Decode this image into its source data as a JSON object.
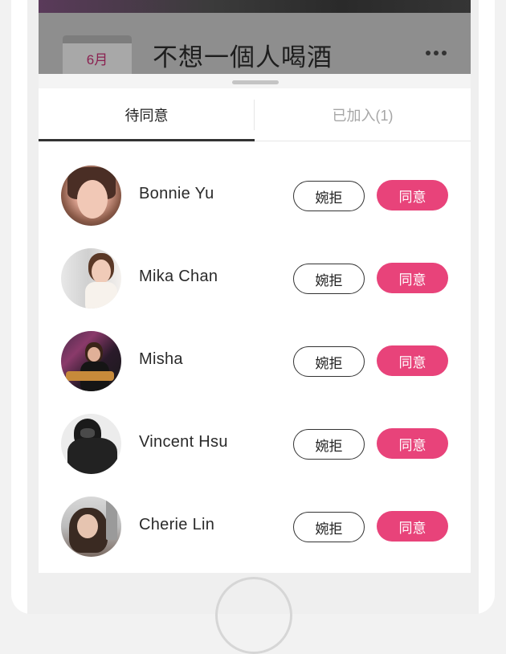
{
  "event": {
    "month": "6月",
    "title": "不想一個人喝酒"
  },
  "tabs": [
    {
      "label": "待同意",
      "active": true
    },
    {
      "label": "已加入(1)",
      "active": false
    }
  ],
  "buttons": {
    "decline_label": "婉拒",
    "accept_label": "同意"
  },
  "requests": [
    {
      "name": "Bonnie Yu",
      "avatar": "avatar-photo"
    },
    {
      "name": "Mika Chan",
      "avatar": "avatar-photo"
    },
    {
      "name": "Misha",
      "avatar": "avatar-photo"
    },
    {
      "name": "Vincent Hsu",
      "avatar": "avatar-photo"
    },
    {
      "name": "Cherie Lin",
      "avatar": "avatar-photo"
    }
  ],
  "colors": {
    "accent": "#e8437a",
    "text": "#2a2a2a",
    "muted": "#a6a6a6"
  }
}
